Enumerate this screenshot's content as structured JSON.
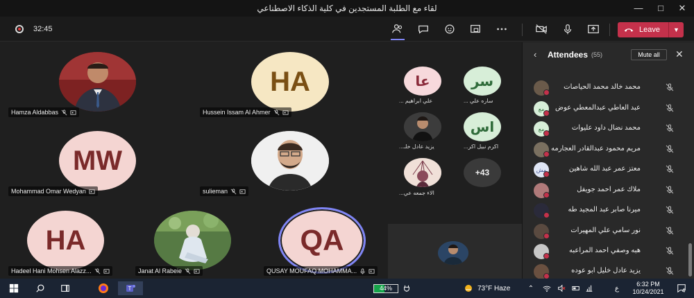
{
  "window": {
    "title": "لقاء مع الطلبة المستجدين في كلية الذكاء الاصطناعي"
  },
  "toolbar": {
    "timer": "32:45",
    "leave_label": "Leave",
    "accent_leave": "#c4314b",
    "icons": [
      "participants-icon",
      "chat-icon",
      "reactions-icon",
      "rooms-icon",
      "more-icon",
      "camera-off-icon",
      "mic-icon",
      "share-icon"
    ]
  },
  "stage": {
    "tiles": [
      {
        "name": "Hamza Aldabbas",
        "initials": ""
      },
      {
        "name": "Hussein Issam Al Ahmer",
        "initials": "HA"
      },
      {
        "name": "Mohammad Omar Wedyan",
        "initials": "MW"
      },
      {
        "name": "sulieman",
        "initials": ""
      },
      {
        "name": "Hadeel Hani Mohsen Alazz...",
        "initials": "HA"
      },
      {
        "name": "Janat Al Rabeie",
        "initials": ""
      },
      {
        "name": "QUSAY MOUFAQ MOHAMMA...",
        "initials": "QA"
      }
    ],
    "small_tiles": [
      {
        "name": "ساره علي ...",
        "initials": "سر"
      },
      {
        "name": "علي ابراهيم ...",
        "initials": "عا"
      },
      {
        "name": "اكرم نبيل اكر...",
        "initials": "اس"
      },
      {
        "name": "يزيد عادل خلـ...",
        "initials": ""
      },
      {
        "name": "الاء جمعه عي...",
        "initials": ""
      }
    ],
    "overflow_count": "+43"
  },
  "panel": {
    "title": "Attendees",
    "count": "(55)",
    "mute_all_label": "Mute all",
    "attendees": [
      {
        "name": "محمد خالد محمد الحياصات",
        "initials": ""
      },
      {
        "name": "عبد العاطي عبدالمعطي عوض",
        "initials": "مع"
      },
      {
        "name": "محمد نضال داود عليوات",
        "initials": "مع"
      },
      {
        "name": "مريم محمود عبدالقادر العجارمه",
        "initials": ""
      },
      {
        "name": "معتز عمر عبد الله شاهين",
        "initials": "مش"
      },
      {
        "name": "ملاك عمر احمد جويفل",
        "initials": ""
      },
      {
        "name": "ميرنا صابر عبد المجيد طه",
        "initials": ""
      },
      {
        "name": "نور سامي علي المهيرات",
        "initials": ""
      },
      {
        "name": "هبه وصفي احمد المراعبه",
        "initials": ""
      },
      {
        "name": "يزيد عادل خليل ابو عوده",
        "initials": ""
      }
    ]
  },
  "taskbar": {
    "battery": "44%",
    "battery_level": 0.44,
    "weather": "73°F  Haze",
    "lang": "ع",
    "time": "6:32 PM",
    "date": "10/24/2021",
    "notifications": "4"
  }
}
